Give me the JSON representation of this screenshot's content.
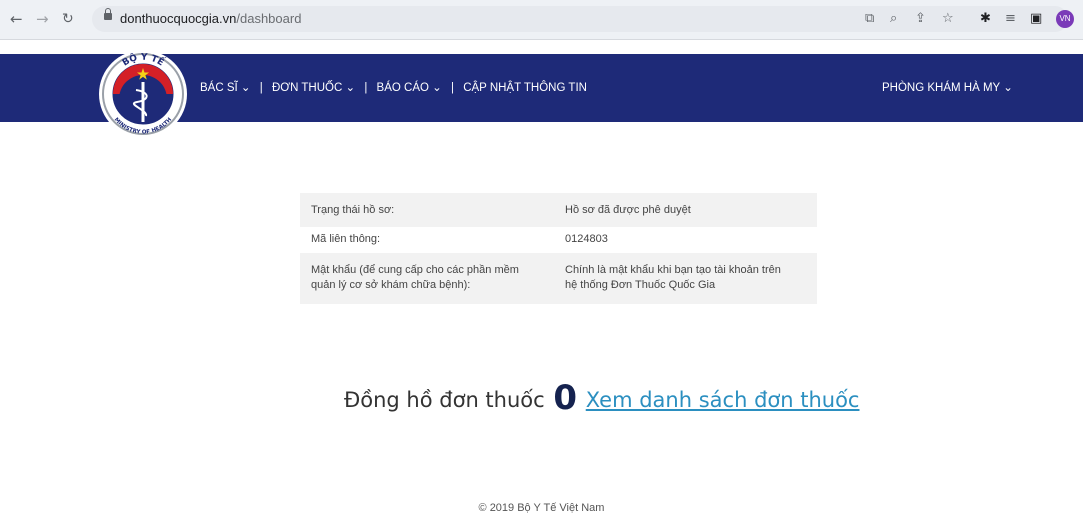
{
  "browser": {
    "url_host": "donthuocquocgia.vn",
    "url_path": "/dashboard",
    "profile_initials": "VN"
  },
  "header": {
    "logo_text_top": "BỘ Y TẾ",
    "logo_text_bottom": "MINISTRY OF HEALTH",
    "menu": [
      {
        "label": "BÁC SĨ ⌄"
      },
      {
        "label": "ĐƠN THUỐC ⌄"
      },
      {
        "label": "BÁO CÁO ⌄"
      },
      {
        "label": "CẬP NHẬT THÔNG TIN"
      }
    ],
    "separator": "|",
    "clinic_label": "PHÒNG KHÁM HÀ MY ⌄",
    "bg_color": "#1e2a78"
  },
  "info_rows": [
    {
      "label": "Trạng thái hồ sơ:",
      "value": "Hồ sơ đã được phê duyệt"
    },
    {
      "label": "Mã liên thông:",
      "value": "0124803"
    },
    {
      "label_line1": "Mật khẩu (để cung cấp cho các phần mềm",
      "label_line2": "quản lý cơ sở khám chữa bệnh):",
      "value_line1": "Chính là mật khẩu khi bạn tạo tài khoản trên",
      "value_line2": "hệ thống Đơn Thuốc Quốc Gia"
    }
  ],
  "counter": {
    "label": "Đồng hồ đơn thuốc",
    "count": "0",
    "link_text": "Xem danh sách đơn thuốc"
  },
  "footer": {
    "text": "© 2019 Bộ Y Tế Việt Nam"
  },
  "colors": {
    "link": "#2b8fc0",
    "counter_number": "#15224f"
  }
}
